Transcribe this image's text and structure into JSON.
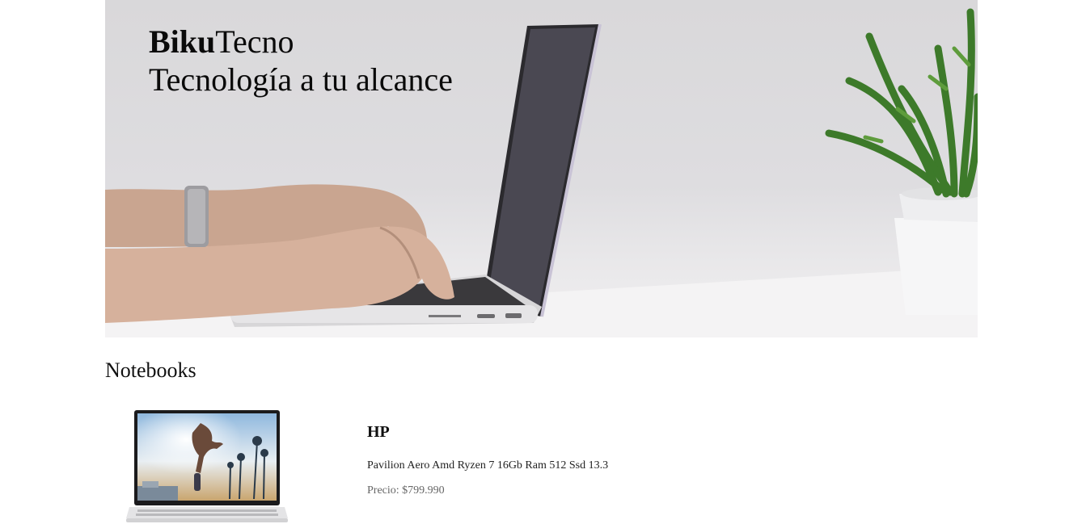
{
  "hero": {
    "brand_bold": "Biku",
    "brand_regular": "Tecno",
    "tagline": "Tecnología a tu alcance"
  },
  "section": {
    "title": "Notebooks"
  },
  "products": [
    {
      "brand": "HP",
      "description": "Pavilion Aero Amd Ryzen 7 16Gb Ram 512 Ssd 13.3",
      "price": "Precio: $799.990"
    }
  ],
  "icons": {
    "hero_image": "laptop-typing-photo",
    "product_image": "hp-laptop-photo"
  },
  "colors": {
    "background": "#ffffff",
    "hero_wall": "#dcdbdd",
    "text": "#111111",
    "price_text": "#666666"
  }
}
